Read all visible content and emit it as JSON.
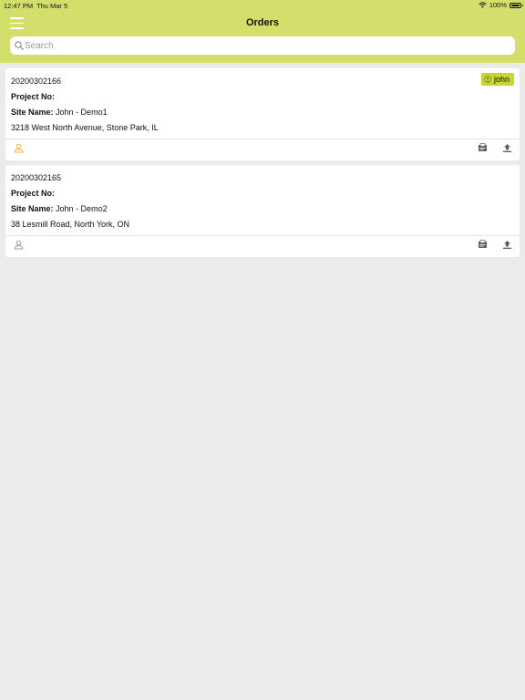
{
  "status_bar": {
    "time": "12:47 PM",
    "date": "Thu Mar 5",
    "battery": "100%"
  },
  "header": {
    "title": "Orders",
    "menu_icon": "hamburger-icon"
  },
  "search": {
    "placeholder": "Search",
    "value": ""
  },
  "orders": [
    {
      "order_number": "20200302166",
      "project_label": "Project No:",
      "project_no": "",
      "site_label": "Site Name:",
      "site_name": "John - Demo1",
      "address": "3218 West North Avenue, Stone Park, IL",
      "assignee": "john",
      "user_icon_color": "#e8b339"
    },
    {
      "order_number": "20200302165",
      "project_label": "Project No:",
      "project_no": "",
      "site_label": "Site Name:",
      "site_name": "John - Demo2",
      "address": "38 Lesmill Road, North York, ON",
      "user_icon_color": "#9a9a9a"
    }
  ],
  "colors": {
    "header": "#d3df6a",
    "tag": "#c8d634",
    "background": "#ebebeb"
  }
}
